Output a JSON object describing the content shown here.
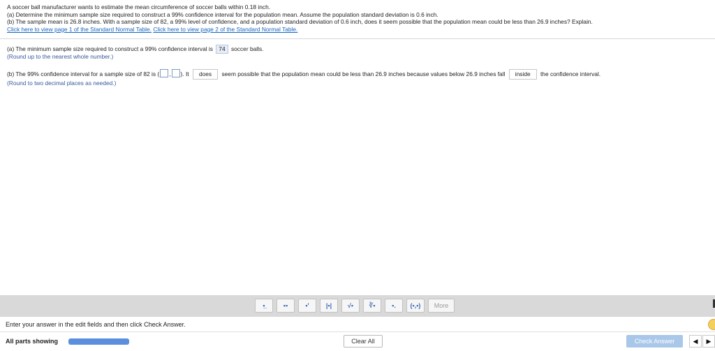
{
  "question": {
    "intro": "A soccer ball manufacturer wants to estimate the mean circumference of soccer balls within 0.18 inch.",
    "part_a": "(a) Determine the minimum sample size required to construct a 99% confidence interval for the population mean. Assume the population standard deviation is 0.6 inch.",
    "part_b": "(b) The sample mean is 26.8 inches. With a sample size of 82, a 99% level of confidence, and a population standard deviation of 0.6 inch, does it seem possible that the population mean could be less than 26.9 inches? Explain.",
    "link1": "Click here to view page 1 of the Standard Normal Table.",
    "link2": "Click here to view page 2 of the Standard Normal Table."
  },
  "answer_a": {
    "prefix": "(a) The minimum sample size required to construct a 99% confidence interval is",
    "value": "74",
    "suffix": "soccer balls.",
    "hint": "(Round up to the nearest whole number.)"
  },
  "answer_b": {
    "prefix": "(b) The 99% confidence interval for a sample size of 82 is (",
    "comma": ",",
    "close": "). It",
    "dropdown1": "does",
    "middle": "seem possible that the population mean could be less than 26.9 inches because values below 26.9 inches fall",
    "dropdown2": "inside",
    "suffix": "the confidence interval.",
    "hint": "(Round to two decimal places as needed.)"
  },
  "toolbar": {
    "tools": [
      {
        "name": "fraction-tool",
        "glyph": "▪̲"
      },
      {
        "name": "mixed-number-tool",
        "glyph": "▪▪"
      },
      {
        "name": "exponent-tool",
        "glyph": "▪'"
      },
      {
        "name": "absolute-value-tool",
        "glyph": "|▪|"
      },
      {
        "name": "square-root-tool",
        "glyph": "√▪"
      },
      {
        "name": "nth-root-tool",
        "glyph": "∛▪"
      },
      {
        "name": "decimal-tool",
        "glyph": "▪."
      },
      {
        "name": "interval-tool",
        "glyph": "(▪,▪)"
      }
    ],
    "more": "More"
  },
  "footer": {
    "instructions": "Enter your answer in the edit fields and then click Check Answer.",
    "parts_label": "All parts showing",
    "clear_all": "Clear All",
    "check_answer": "Check Answer",
    "prev": "◀",
    "next": "▶"
  },
  "colors": {
    "link": "#1565c0",
    "hint": "#3a5a9c",
    "progress": "#5b8fde",
    "check_button": "#a8c7e9",
    "toolbar_bg": "#d9d9d9"
  }
}
